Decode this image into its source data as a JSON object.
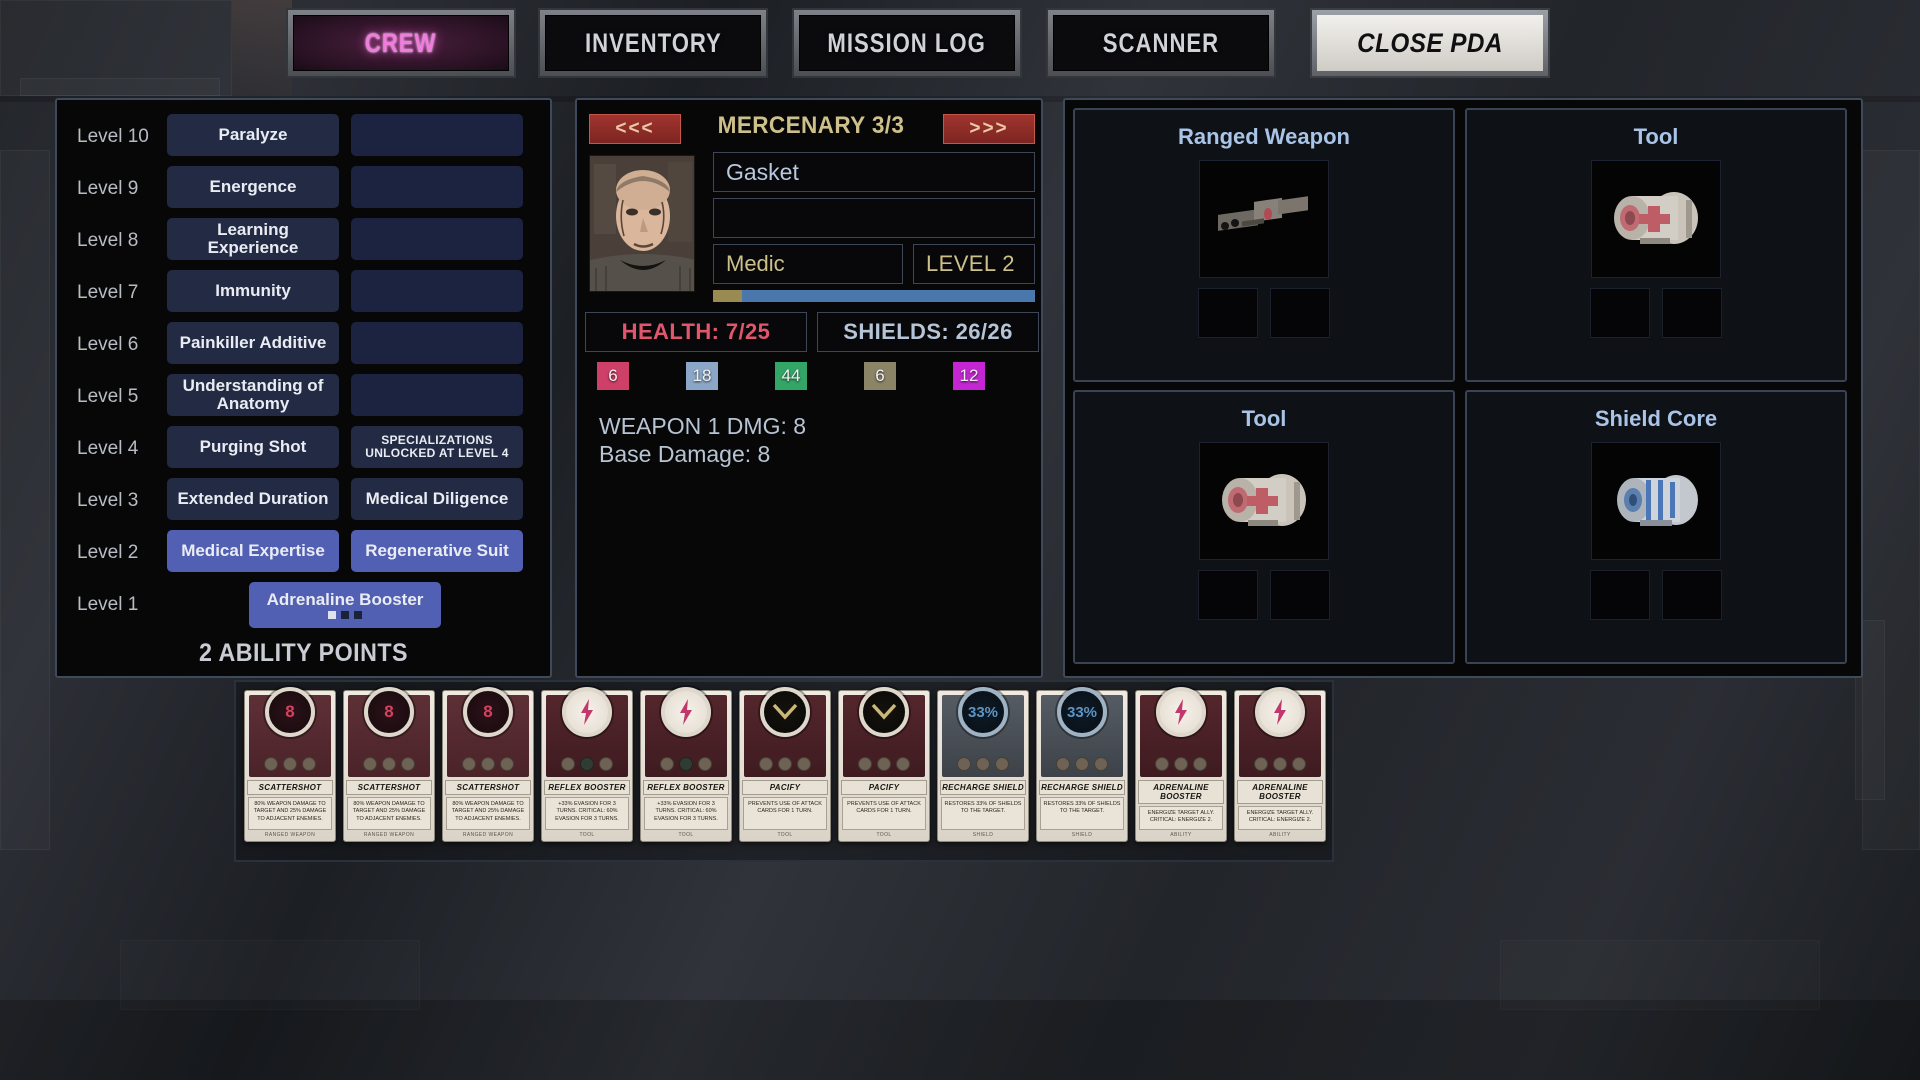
{
  "topbar": {
    "tabs": [
      {
        "label": "CREW",
        "active": true
      },
      {
        "label": "INVENTORY",
        "active": false
      },
      {
        "label": "MISSION LOG",
        "active": false
      },
      {
        "label": "SCANNER",
        "active": false
      }
    ],
    "close_label": "CLOSE PDA"
  },
  "skill_tree": {
    "rows": [
      {
        "level": "Level 10",
        "a": "Paralyze",
        "a_state": "locked",
        "b": "",
        "b_state": "empty"
      },
      {
        "level": "Level 9",
        "a": "Energence",
        "a_state": "locked",
        "b": "",
        "b_state": "empty"
      },
      {
        "level": "Level 8",
        "a": "Learning Experience",
        "a_state": "locked",
        "b": "",
        "b_state": "empty"
      },
      {
        "level": "Level 7",
        "a": "Immunity",
        "a_state": "locked",
        "b": "",
        "b_state": "empty"
      },
      {
        "level": "Level 6",
        "a": "Painkiller Additive",
        "a_state": "locked",
        "b": "",
        "b_state": "empty"
      },
      {
        "level": "Level 5",
        "a": "Understanding of Anatomy",
        "a_state": "locked",
        "b": "",
        "b_state": "empty"
      },
      {
        "level": "Level 4",
        "a": "Purging Shot",
        "a_state": "locked",
        "b": "SPECIALIZATIONS UNLOCKED AT LEVEL 4",
        "b_state": "note"
      },
      {
        "level": "Level 3",
        "a": "Extended Duration",
        "a_state": "locked",
        "b": "Medical Diligence",
        "b_state": "locked"
      },
      {
        "level": "Level 2",
        "a": "Medical Expertise",
        "a_state": "unlocked",
        "b": "Regenerative Suit",
        "b_state": "unlocked"
      }
    ],
    "level1": {
      "level": "Level 1",
      "label": "Adrenaline Booster",
      "state": "unlocked",
      "pips": [
        true,
        false,
        false
      ]
    },
    "ability_points": "2 ABILITY POINTS"
  },
  "character": {
    "prev_label": "<<<",
    "next_label": ">>>",
    "title": "MERCENARY 3/3",
    "name": "Gasket",
    "subtitle": "",
    "class": "Medic",
    "level": "LEVEL 2",
    "health": "HEALTH: 7/25",
    "shields": "SHIELDS: 26/26",
    "stat_badges": [
      {
        "value": "6",
        "color": "#cf4068"
      },
      {
        "value": "18",
        "color": "#8ba7c7"
      },
      {
        "value": "44",
        "color": "#33a566"
      },
      {
        "value": "6",
        "color": "#8b8467"
      },
      {
        "value": "12",
        "color": "#c427d1"
      }
    ],
    "weapon_damage": "WEAPON 1 DMG: 8",
    "base_damage": "Base Damage: 8"
  },
  "equipment": {
    "slots": [
      {
        "title": "Ranged Weapon",
        "item": "rifle-sprite"
      },
      {
        "title": "Tool",
        "item": "canister-sprite"
      },
      {
        "title": "Tool",
        "item": "canister-sprite"
      },
      {
        "title": "Shield Core",
        "item": "shield-core-sprite"
      }
    ]
  },
  "cards": [
    {
      "name": "SCATTERSHOT",
      "desc": "80% WEAPON DAMAGE TO TARGET AND 25% DAMAGE TO ADJACENT ENEMIES.",
      "type": "RANGED WEAPON",
      "art": "red",
      "orb": "dark",
      "orb_text": "8",
      "icon": "number",
      "pip_style": "plain"
    },
    {
      "name": "SCATTERSHOT",
      "desc": "80% WEAPON DAMAGE TO TARGET AND 25% DAMAGE TO ADJACENT ENEMIES.",
      "type": "RANGED WEAPON",
      "art": "red",
      "orb": "dark",
      "orb_text": "8",
      "icon": "number",
      "pip_style": "plain"
    },
    {
      "name": "SCATTERSHOT",
      "desc": "80% WEAPON DAMAGE TO TARGET AND 25% DAMAGE TO ADJACENT ENEMIES.",
      "type": "RANGED WEAPON",
      "art": "red",
      "orb": "dark",
      "orb_text": "8",
      "icon": "number",
      "pip_style": "plain"
    },
    {
      "name": "REFLEX BOOSTER",
      "desc": "+33% EVASION FOR 3 TURNS. CRITICAL: 60% EVASION FOR 3 TURNS.",
      "type": "TOOL",
      "art": "dred",
      "orb": "light",
      "orb_text": "",
      "icon": "bolt",
      "pip_style": "chev"
    },
    {
      "name": "REFLEX BOOSTER",
      "desc": "+33% EVASION FOR 3 TURNS. CRITICAL: 60% EVASION FOR 3 TURNS.",
      "type": "TOOL",
      "art": "dred",
      "orb": "light",
      "orb_text": "",
      "icon": "bolt",
      "pip_style": "chev"
    },
    {
      "name": "PACIFY",
      "desc": "PREVENTS USE OF ATTACK CARDS FOR 1 TURN.",
      "type": "TOOL",
      "art": "dred",
      "orb": "black",
      "orb_text": "",
      "icon": "chev",
      "pip_style": "plain"
    },
    {
      "name": "PACIFY",
      "desc": "PREVENTS USE OF ATTACK CARDS FOR 1 TURN.",
      "type": "TOOL",
      "art": "dred",
      "orb": "black",
      "orb_text": "",
      "icon": "chev",
      "pip_style": "plain"
    },
    {
      "name": "RECHARGE SHIELD",
      "desc": "RESTORES 33% OF SHIELDS TO THE TARGET.",
      "type": "SHIELD",
      "art": "gray",
      "orb": "shield",
      "orb_text": "33%",
      "icon": "number",
      "pip_style": "plain"
    },
    {
      "name": "RECHARGE SHIELD",
      "desc": "RESTORES 33% OF SHIELDS TO THE TARGET.",
      "type": "SHIELD",
      "art": "gray",
      "orb": "shield",
      "orb_text": "33%",
      "icon": "number",
      "pip_style": "plain"
    },
    {
      "name": "ADRENALINE BOOSTER",
      "desc": "ENERGIZE TARGET ALLY. CRITICAL: ENERGIZE 2.",
      "type": "ABILITY",
      "art": "dred",
      "orb": "light",
      "orb_text": "",
      "icon": "bolt",
      "pip_style": "plain"
    },
    {
      "name": "ADRENALINE BOOSTER",
      "desc": "ENERGIZE TARGET ALLY. CRITICAL: ENERGIZE 2.",
      "type": "ABILITY",
      "art": "dred",
      "orb": "light",
      "orb_text": "",
      "icon": "bolt",
      "pip_style": "plain"
    }
  ]
}
